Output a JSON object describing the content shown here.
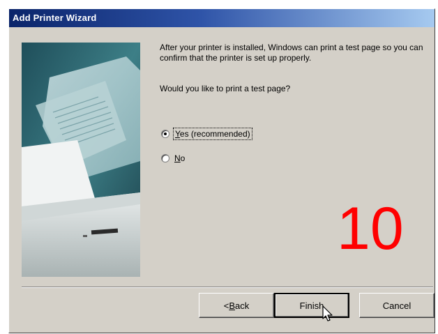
{
  "window": {
    "title": "Add Printer Wizard"
  },
  "content": {
    "description": "After your printer is installed, Windows can print a test page so you can confirm that the printer is set up properly.",
    "question": "Would you like to print a test page?",
    "options": [
      {
        "label_prefix": "",
        "mnemonic": "Y",
        "label_rest": "es (recommended)",
        "selected": true
      },
      {
        "label_prefix": "",
        "mnemonic": "N",
        "label_rest": "o",
        "selected": false
      }
    ]
  },
  "overlay": {
    "step_number": "10",
    "color": "#ff0000"
  },
  "buttons": {
    "back": {
      "prefix": "< ",
      "mnemonic": "B",
      "rest": "ack"
    },
    "finish": {
      "label": "Finish"
    },
    "cancel": {
      "label": "Cancel"
    }
  },
  "colors": {
    "titlebar_start": "#0a246a",
    "face": "#d4d0c8"
  },
  "icons": {
    "art": "printer-illustration",
    "cursor": "mouse-pointer-icon"
  }
}
